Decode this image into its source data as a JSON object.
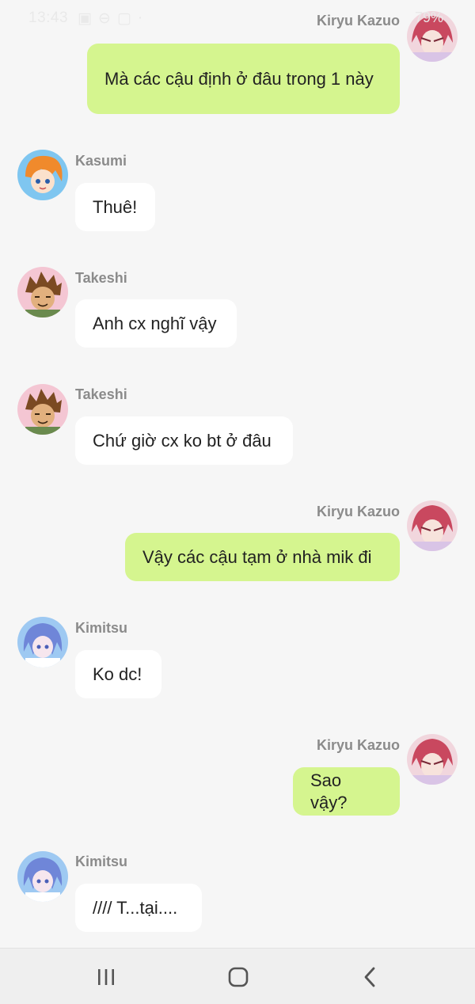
{
  "status_bar": {
    "time": "13:43",
    "battery": "79%"
  },
  "messages": [
    {
      "side": "right",
      "sender": "Kiryu Kazuo",
      "text": "Mà các cậu định ở đâu trong 1 này",
      "avatar": "kiryu-avatar"
    },
    {
      "side": "left",
      "sender": "Kasumi",
      "text": "Thuê!",
      "avatar": "kasumi-avatar"
    },
    {
      "side": "left",
      "sender": "Takeshi",
      "text": "Anh cx nghĩ vậy",
      "avatar": "takeshi-avatar"
    },
    {
      "side": "left",
      "sender": "Takeshi",
      "text": "Chứ giờ cx ko bt ở đâu",
      "avatar": "takeshi-avatar"
    },
    {
      "side": "right",
      "sender": "Kiryu Kazuo",
      "text": "Vậy các cậu tạm ở nhà mik đi",
      "avatar": "kiryu-avatar"
    },
    {
      "side": "left",
      "sender": "Kimitsu",
      "text": "Ko dc!",
      "avatar": "kimitsu-avatar"
    },
    {
      "side": "right",
      "sender": "Kiryu Kazuo",
      "text": "Sao vậy?",
      "avatar": "kiryu-avatar"
    },
    {
      "side": "left",
      "sender": "Kimitsu",
      "text": "//// T...tại....",
      "avatar": "kimitsu-avatar"
    }
  ],
  "nav_bar": {
    "recent_icon": "recent-apps-icon",
    "home_icon": "home-icon",
    "back_icon": "back-icon"
  },
  "colors": {
    "background": "#f6f6f6",
    "outgoing_bubble": "#d5f58f",
    "incoming_bubble": "#ffffff",
    "name_text": "#8b8b8b"
  }
}
